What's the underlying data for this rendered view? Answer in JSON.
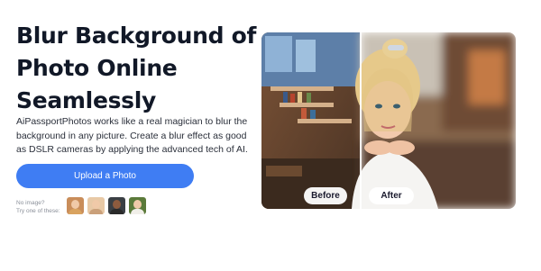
{
  "hero": {
    "title": "Blur Background of Photo Online Seamlessly",
    "description": "AiPassportPhotos works like a real magician to blur the background in any picture. Create a blur effect as good as DSLR cameras by applying the advanced tech of AI.",
    "upload_label": "Upload a Photo"
  },
  "samples": {
    "line1": "No image?",
    "line2": "Try one of these:",
    "thumbs": [
      {
        "name": "sample-photo-1",
        "bg": "#c98d5a",
        "cloth": "#d9a35f"
      },
      {
        "name": "sample-photo-2",
        "bg": "#e8c9a6",
        "cloth": "#caa07a"
      },
      {
        "name": "sample-photo-3",
        "bg": "#3a3f44",
        "cloth": "#2a2a2a"
      },
      {
        "name": "sample-photo-4",
        "bg": "#5b7a3a",
        "cloth": "#f1efe9"
      }
    ]
  },
  "comparison": {
    "before_label": "Before",
    "after_label": "After"
  },
  "colors": {
    "accent": "#3f7df3",
    "title": "#111827"
  }
}
